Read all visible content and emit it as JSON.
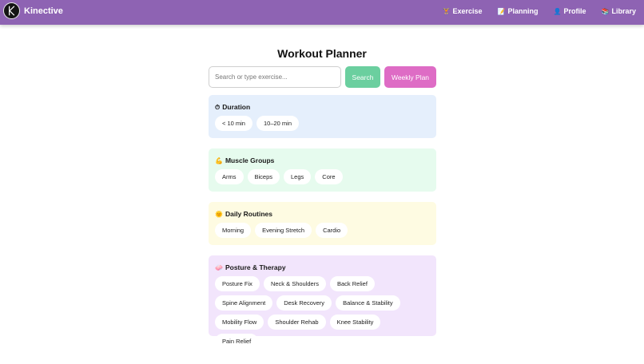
{
  "nav": {
    "brand": "Kinective",
    "links": [
      {
        "icon": "🏋",
        "label": "Exercise"
      },
      {
        "icon": "📝",
        "label": "Planning"
      },
      {
        "icon": "👤",
        "label": "Profile"
      },
      {
        "icon": "📚",
        "label": "Library"
      }
    ]
  },
  "page": {
    "title": "Workout Planner"
  },
  "search": {
    "placeholder": "Search or type exercise...",
    "value": "",
    "search_label": "Search",
    "weekly_label": "Weekly Plan"
  },
  "sections": {
    "duration": {
      "icon": "⏱",
      "title": "Duration",
      "tags": [
        "< 10 min",
        "10–20 min"
      ]
    },
    "muscle": {
      "icon": "💪",
      "title": "Muscle Groups",
      "tags": [
        "Arms",
        "Biceps",
        "Legs",
        "Core"
      ]
    },
    "daily": {
      "icon": "🌞",
      "title": "Daily Routines",
      "tags": [
        "Morning",
        "Evening Stretch",
        "Cardio"
      ]
    },
    "posture": {
      "icon": "🧼",
      "title": "Posture & Therapy",
      "tags": [
        "Posture Fix",
        "Neck & Shoulders",
        "Back Relief",
        "Spine Alignment",
        "Desk Recovery",
        "Balance & Stability",
        "Mobility Flow",
        "Shoulder Rehab",
        "Knee Stability",
        "Pain Relief"
      ]
    }
  },
  "colors": {
    "navbar": "#8e63b3",
    "search_button": "#6bcf9f",
    "weekly_button": "#de6cc5",
    "duration_bg": "#e5effc",
    "muscle_bg": "#e6fbee",
    "daily_bg": "#fefbe2",
    "posture_bg": "#f2e5fc"
  }
}
